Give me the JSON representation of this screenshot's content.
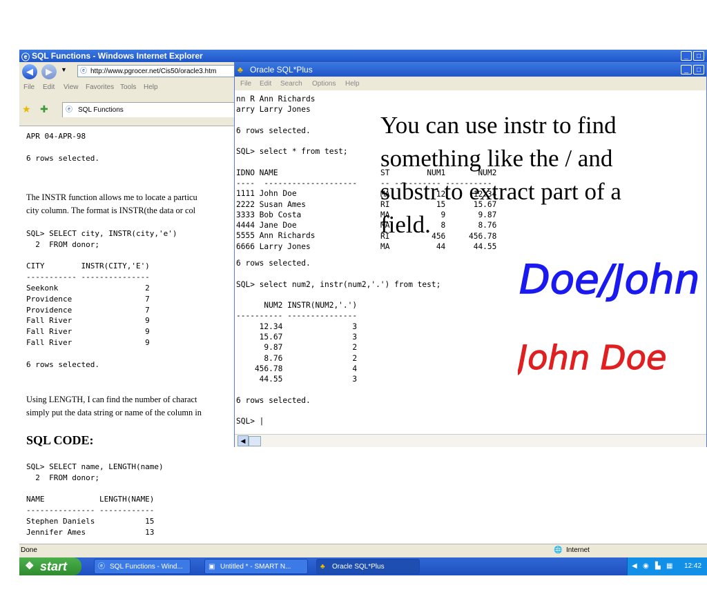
{
  "ie": {
    "title": "SQL Functions - Windows Internet Explorer",
    "address": "http://www.pgrocer.net/Cis50/oracle3.htm",
    "menu": [
      "File",
      "Edit",
      "View",
      "Favorites",
      "Tools",
      "Help"
    ],
    "tab_label": "SQL Functions",
    "status_left": "Done",
    "status_zone": "Internet",
    "content": {
      "pre1": "APR 04-APR-98\n\n6 rows selected.",
      "para1_line1": "The INSTR function allows me to locate a particu",
      "para1_line2": "city column. The format is INSTR(the data or col",
      "pre2": "SQL> SELECT city, INSTR(city,'e')\n  2  FROM donor;\n\nCITY        INSTR(CITY,'E')\n----------- ---------------\nSeekonk                   2\nProvidence                7\nProvidence                7\nFall River                9\nFall River                9\nFall River                9\n\n6 rows selected.",
      "para2_line1": "Using LENGTH, I can find the number of charact",
      "para2_line2": "simply put the data string or name of the column in",
      "heading": "SQL CODE:",
      "pre3": "SQL> SELECT name, LENGTH(name)\n  2  FROM donor;\n\nNAME            LENGTH(NAME)\n--------------- ------------\nStephen Daniels           15\nJennifer Ames             13"
    }
  },
  "sqlplus": {
    "title": "Oracle SQL*Plus",
    "menu": [
      "File",
      "Edit",
      "Search",
      "Options",
      "Help"
    ],
    "pre_top": "nn R Ann Richards\narry Larry Jones\n\n6 rows selected.\n\nSQL> select * from test;\n\nIDNO NAME",
    "pre_table_rows": "----  --------------------\n1111 John Doe\n2222 Susan Ames\n3333 Bob Costa\n4444 Jane Doe\n5555 Ann Richards\n6666 Larry Jones",
    "pre_table_right": "ST        NUM1       NUM2\n-- ---------- ----------\nMA          12      12.34\nRI          15      15.67\nMA           9       9.87\nMA           8       8.76\nRI         456     456.78\nMA          44      44.55",
    "pre_bottom": "6 rows selected.\n\nSQL> select num2, instr(num2,'.') from test;\n\n      NUM2 INSTR(NUM2,'.')\n---------- ---------------\n     12.34               3\n     15.67               3\n      9.87               2\n      8.76               2\n    456.78               4\n     44.55               3\n\n6 rows selected.\n\nSQL> |"
  },
  "overlay": {
    "text_line1": "You can use instr to find",
    "text_line2": "something like the / and",
    "text_line3": "substr to extract part of a",
    "text_line4": "field.",
    "handwriting_blue": "Doe/John",
    "handwriting_red": "John Doe",
    "blue_color": "#1a1aee",
    "red_color": "#e02020"
  },
  "taskbar": {
    "start": "start",
    "tasks": [
      "SQL Functions - Wind...",
      "Untitled * - SMART N...",
      "Oracle SQL*Plus"
    ],
    "clock": "12:42"
  }
}
